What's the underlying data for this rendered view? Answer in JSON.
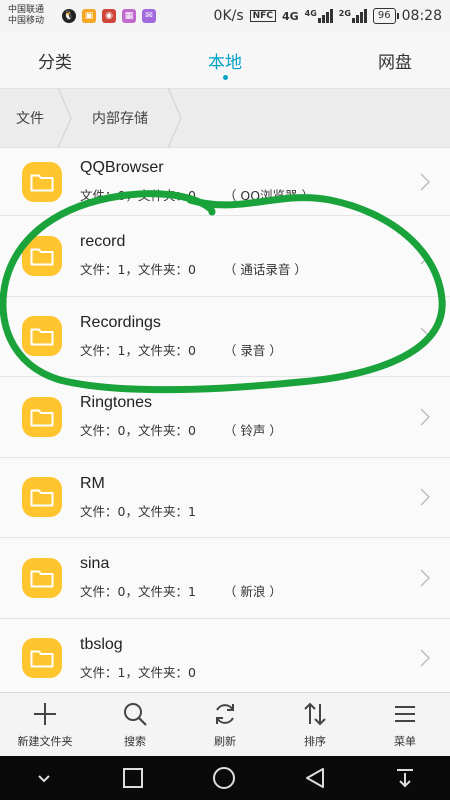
{
  "status_bar": {
    "carrier1": "中国联通",
    "carrier2": "中国移动",
    "speed": "0K/s",
    "nfc": "NFC",
    "net1": "4G",
    "net2": "4G",
    "net3": "2G",
    "battery": "96",
    "time": "08:28"
  },
  "tabs": [
    {
      "label": "分类"
    },
    {
      "label": "本地"
    },
    {
      "label": "网盘"
    }
  ],
  "active_tab": "本地",
  "breadcrumb": [
    {
      "label": "文件"
    },
    {
      "label": "内部存储"
    }
  ],
  "files": [
    {
      "name": "QQBrowser",
      "meta": "文件：0，文件夹：0",
      "alias": "（ QQ浏览器 ）"
    },
    {
      "name": "record",
      "meta": "文件：1，文件夹：0",
      "alias": "（ 通话录音 ）"
    },
    {
      "name": "Recordings",
      "meta": "文件：1，文件夹：0",
      "alias": "（ 录音 ）"
    },
    {
      "name": "Ringtones",
      "meta": "文件：0，文件夹：0",
      "alias": "（ 铃声 ）"
    },
    {
      "name": "RM",
      "meta": "文件：0，文件夹：1",
      "alias": ""
    },
    {
      "name": "sina",
      "meta": "文件：0，文件夹：1",
      "alias": "（ 新浪 ）"
    },
    {
      "name": "tbslog",
      "meta": "文件：1，文件夹：0",
      "alias": ""
    }
  ],
  "toolbar": [
    {
      "label": "新建文件夹",
      "icon": "plus-icon"
    },
    {
      "label": "搜索",
      "icon": "search-icon"
    },
    {
      "label": "刷新",
      "icon": "refresh-icon"
    },
    {
      "label": "排序",
      "icon": "sort-icon"
    },
    {
      "label": "菜单",
      "icon": "menu-icon"
    }
  ],
  "colors": {
    "accent": "#00a2c8",
    "folder": "#ffc52f",
    "annotation": "#1aa33a"
  }
}
